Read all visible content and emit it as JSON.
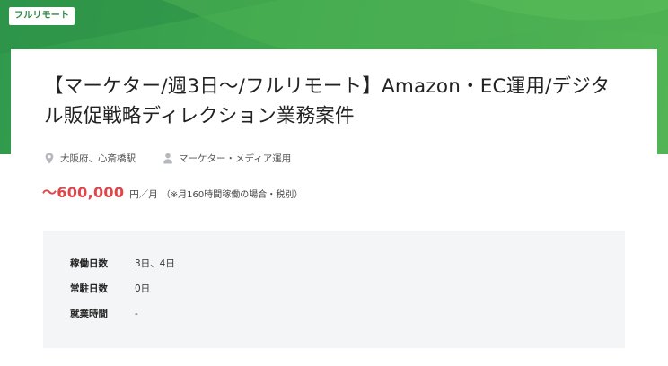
{
  "badge": "フルリモート",
  "title": "【マーケター/週3日〜/フルリモート】Amazon・EC運用/デジタル販促戦略ディレクション業務案件",
  "meta": {
    "location": "大阪府、心斎橋駅",
    "location_icon": "map-pin-icon",
    "category": "マーケター・メディア運用",
    "category_icon": "person-icon"
  },
  "price": {
    "amount": "〜600,000",
    "unit": "円／月",
    "note": "（※月160時間稼働の場合・税別）"
  },
  "details": [
    {
      "label": "稼働日数",
      "value": "3日、4日"
    },
    {
      "label": "常駐日数",
      "value": "0日"
    },
    {
      "label": "就業時間",
      "value": "-"
    }
  ],
  "colors": {
    "hero_green": "#3fa84f",
    "price_red": "#e0454a",
    "detail_bg": "#f4f5f7"
  }
}
